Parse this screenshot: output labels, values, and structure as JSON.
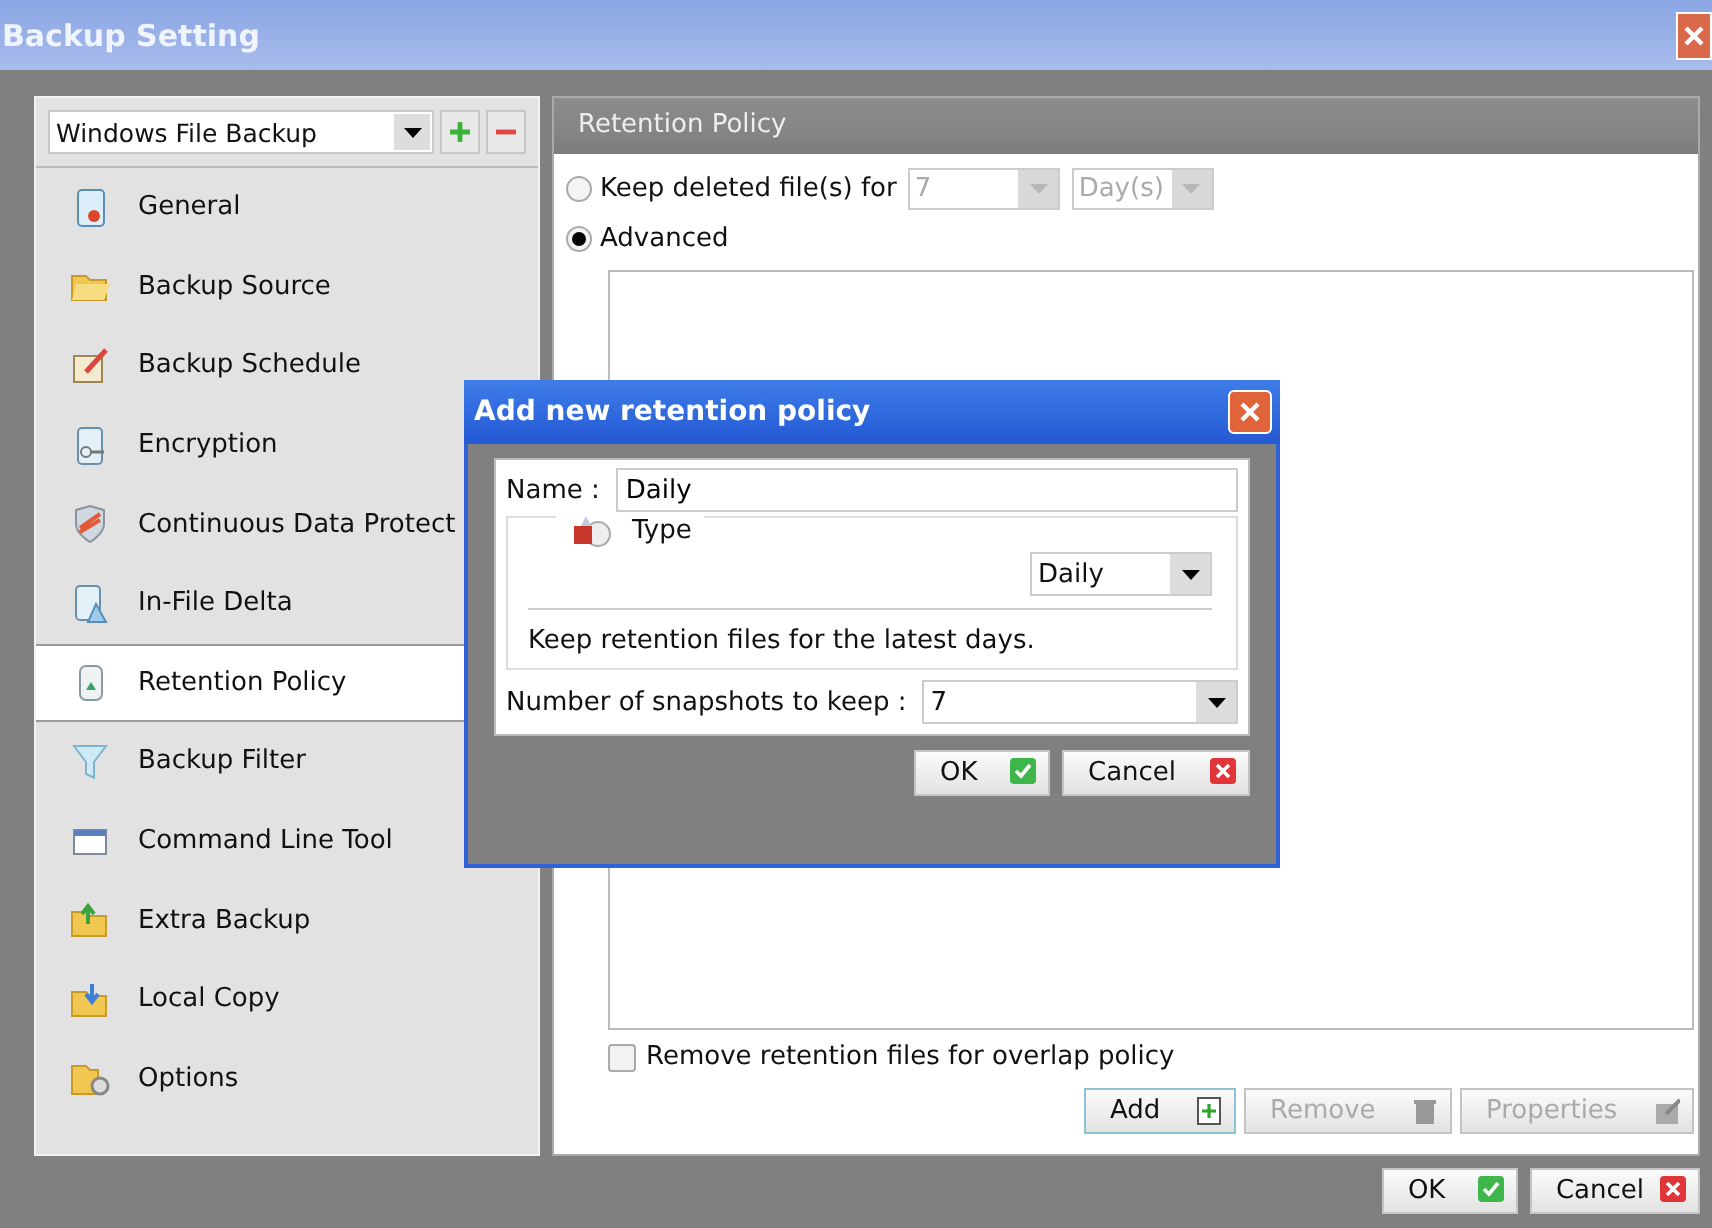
{
  "window": {
    "title": "Backup Setting"
  },
  "sidebar": {
    "backup_set": "Windows File Backup",
    "items": [
      {
        "label": "General",
        "selected": false
      },
      {
        "label": "Backup Source",
        "selected": false
      },
      {
        "label": "Backup Schedule",
        "selected": false
      },
      {
        "label": "Encryption",
        "selected": false
      },
      {
        "label": "Continuous Data Protect",
        "selected": false
      },
      {
        "label": "In-File Delta",
        "selected": false
      },
      {
        "label": "Retention Policy",
        "selected": true
      },
      {
        "label": "Backup Filter",
        "selected": false
      },
      {
        "label": "Command Line Tool",
        "selected": false
      },
      {
        "label": "Extra Backup",
        "selected": false
      },
      {
        "label": "Local Copy",
        "selected": false
      },
      {
        "label": "Options",
        "selected": false
      }
    ]
  },
  "panel": {
    "title": "Retention Policy",
    "options": [
      {
        "label": "Keep deleted file(s) for",
        "selected": false,
        "fields": [
          {
            "value": "7",
            "disabled": true
          },
          {
            "value": "Day(s)",
            "disabled": true
          }
        ]
      },
      {
        "label": "Advanced",
        "selected": true
      }
    ],
    "overlap_checkbox": {
      "label": "Remove retention files for overlap policy",
      "checked": false
    },
    "buttons": [
      {
        "label": "Add",
        "kind": "add",
        "disabled": false
      },
      {
        "label": "Remove",
        "kind": "remove",
        "disabled": true
      },
      {
        "label": "Properties",
        "kind": "edit",
        "disabled": true
      }
    ]
  },
  "footer_buttons": [
    {
      "label": "OK",
      "kind": "ok"
    },
    {
      "label": "Cancel",
      "kind": "cancel"
    }
  ],
  "dialog": {
    "title": "Add new retention policy",
    "name_label": "Name :",
    "name_value": "Daily",
    "type_label": "Type",
    "type_value": "Daily",
    "description": "Keep retention files for the latest days.",
    "snapshots_label": "Number of snapshots to keep :",
    "snapshots_value": "7",
    "buttons": [
      {
        "label": "OK",
        "kind": "ok"
      },
      {
        "label": "Cancel",
        "kind": "cancel"
      }
    ]
  }
}
